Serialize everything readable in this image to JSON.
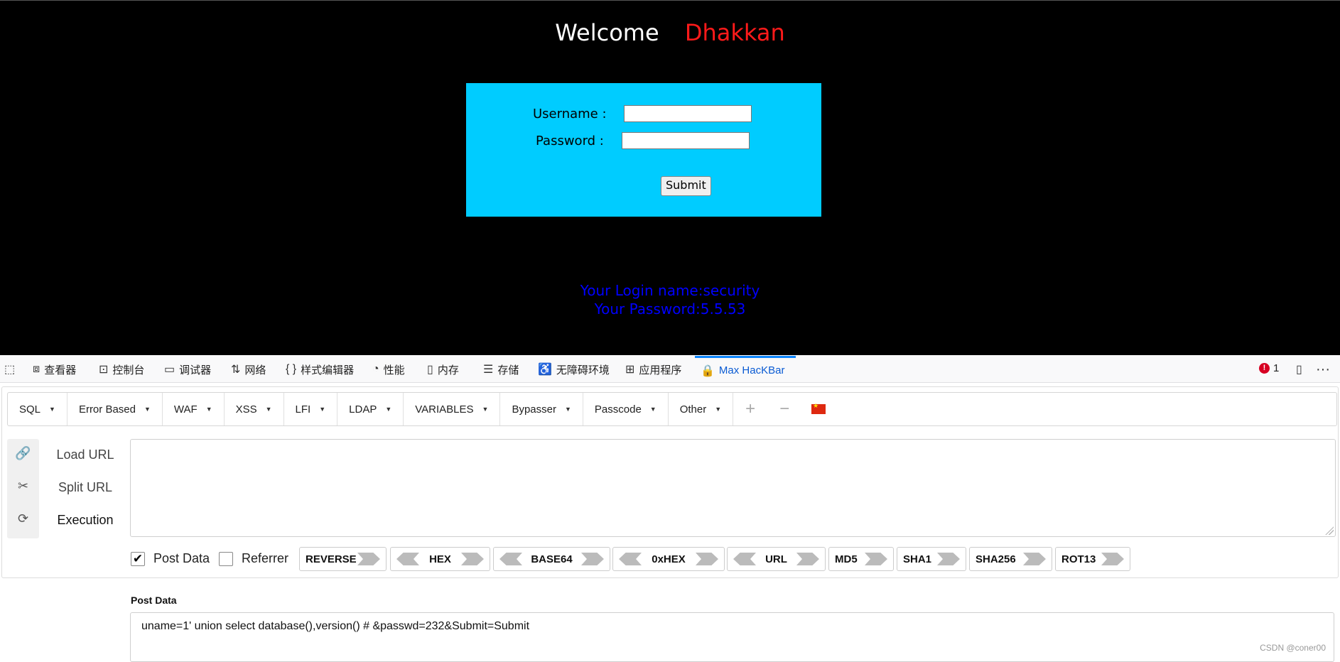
{
  "page": {
    "welcome": "Welcome",
    "user": "Dhakkan",
    "username_label": "Username :",
    "password_label": "Password :",
    "submit": "Submit",
    "login_name_line": "Your Login name:security",
    "password_line": "Your Password:5.5.53"
  },
  "devtools": {
    "tabs": [
      {
        "label": "查看器",
        "icon": "inspector-icon"
      },
      {
        "label": "控制台",
        "icon": "console-icon"
      },
      {
        "label": "调试器",
        "icon": "debugger-icon"
      },
      {
        "label": "网络",
        "icon": "network-icon"
      },
      {
        "label": "样式编辑器",
        "icon": "style-editor-icon"
      },
      {
        "label": "性能",
        "icon": "performance-icon"
      },
      {
        "label": "内存",
        "icon": "memory-icon"
      },
      {
        "label": "存储",
        "icon": "storage-icon"
      },
      {
        "label": "无障碍环境",
        "icon": "accessibility-icon"
      },
      {
        "label": "应用程序",
        "icon": "application-icon"
      },
      {
        "label": "Max HacKBar",
        "icon": "lock-icon",
        "active": true
      }
    ],
    "error_count": "1"
  },
  "hackbar": {
    "menus": [
      "SQL",
      "Error Based",
      "WAF",
      "XSS",
      "LFI",
      "LDAP",
      "VARIABLES",
      "Bypasser",
      "Passcode",
      "Other"
    ],
    "actions": [
      "Load URL",
      "Split URL",
      "Execution"
    ],
    "url_value": "",
    "post_data_checkbox": "Post Data",
    "post_data_checked": true,
    "referrer_checkbox": "Referrer",
    "referrer_checked": false,
    "encoders": [
      "REVERSE",
      "HEX",
      "BASE64",
      "0xHEX",
      "URL",
      "MD5",
      "SHA1",
      "SHA256",
      "ROT13"
    ],
    "post_data_label": "Post Data",
    "post_data_value": "uname=1' union select database(),version() # &passwd=232&Submit=Submit"
  },
  "watermark": "CSDN @coner00",
  "colors": {
    "login_box": "#00ccff",
    "welcome_name": "#ff1a1a",
    "result_text": "#0000ff"
  }
}
